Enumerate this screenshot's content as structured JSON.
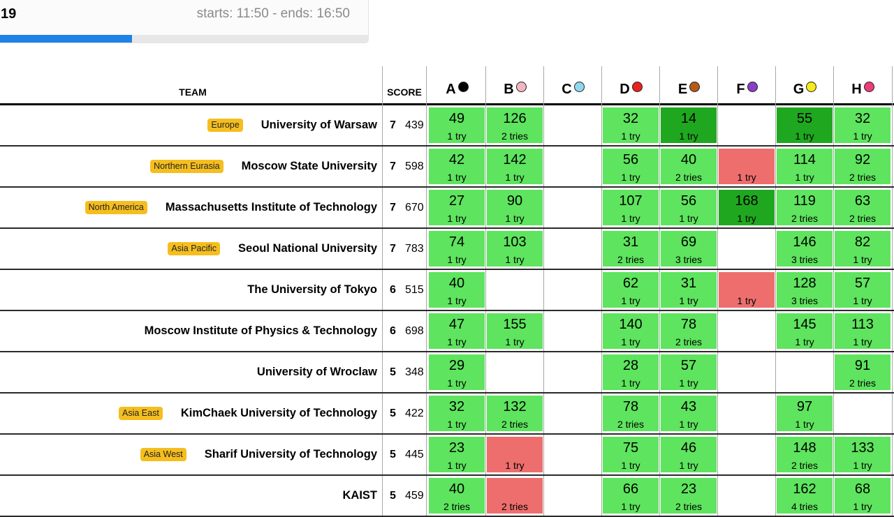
{
  "contest": {
    "id": "19",
    "time": "starts: 11:50 - ends: 16:50",
    "progress_percent": 37
  },
  "header": {
    "team": "TEAM",
    "score": "SCORE"
  },
  "problems": [
    {
      "letter": "A",
      "color": "#000000"
    },
    {
      "letter": "B",
      "color": "#f2b6c2"
    },
    {
      "letter": "C",
      "color": "#8fd8f0"
    },
    {
      "letter": "D",
      "color": "#e8221c"
    },
    {
      "letter": "E",
      "color": "#b45a16"
    },
    {
      "letter": "F",
      "color": "#8a3fc4"
    },
    {
      "letter": "G",
      "color": "#f5ea1a"
    },
    {
      "letter": "H",
      "color": "#ee3b7a"
    }
  ],
  "teams": [
    {
      "region": "Europe",
      "name": "University of Warsaw",
      "solved": "7",
      "penalty": "439",
      "cells": [
        {
          "status": "ok",
          "time": "49",
          "tries": "1 try"
        },
        {
          "status": "ok",
          "time": "126",
          "tries": "2 tries"
        },
        null,
        {
          "status": "ok",
          "time": "32",
          "tries": "1 try"
        },
        {
          "status": "first",
          "time": "14",
          "tries": "1 try"
        },
        null,
        {
          "status": "first",
          "time": "55",
          "tries": "1 try"
        },
        {
          "status": "ok",
          "time": "32",
          "tries": "1 try"
        }
      ]
    },
    {
      "region": "Northern Eurasia",
      "name": "Moscow State University",
      "solved": "7",
      "penalty": "598",
      "cells": [
        {
          "status": "ok",
          "time": "42",
          "tries": "1 try"
        },
        {
          "status": "ok",
          "time": "142",
          "tries": "1 try"
        },
        null,
        {
          "status": "ok",
          "time": "56",
          "tries": "1 try"
        },
        {
          "status": "ok",
          "time": "40",
          "tries": "2 tries"
        },
        {
          "status": "fail",
          "time": "",
          "tries": "1 try"
        },
        {
          "status": "ok",
          "time": "114",
          "tries": "1 try"
        },
        {
          "status": "ok",
          "time": "92",
          "tries": "2 tries"
        }
      ]
    },
    {
      "region": "North America",
      "name": "Massachusetts Institute of Technology",
      "solved": "7",
      "penalty": "670",
      "cells": [
        {
          "status": "ok",
          "time": "27",
          "tries": "1 try"
        },
        {
          "status": "ok",
          "time": "90",
          "tries": "1 try"
        },
        null,
        {
          "status": "ok",
          "time": "107",
          "tries": "1 try"
        },
        {
          "status": "ok",
          "time": "56",
          "tries": "1 try"
        },
        {
          "status": "first",
          "time": "168",
          "tries": "1 try"
        },
        {
          "status": "ok",
          "time": "119",
          "tries": "2 tries"
        },
        {
          "status": "ok",
          "time": "63",
          "tries": "2 tries"
        }
      ]
    },
    {
      "region": "Asia Pacific",
      "name": "Seoul National University",
      "solved": "7",
      "penalty": "783",
      "cells": [
        {
          "status": "ok",
          "time": "74",
          "tries": "1 try"
        },
        {
          "status": "ok",
          "time": "103",
          "tries": "1 try"
        },
        null,
        {
          "status": "ok",
          "time": "31",
          "tries": "2 tries"
        },
        {
          "status": "ok",
          "time": "69",
          "tries": "3 tries"
        },
        null,
        {
          "status": "ok",
          "time": "146",
          "tries": "3 tries"
        },
        {
          "status": "ok",
          "time": "82",
          "tries": "1 try"
        }
      ]
    },
    {
      "region": "",
      "name": "The University of Tokyo",
      "solved": "6",
      "penalty": "515",
      "cells": [
        {
          "status": "ok",
          "time": "40",
          "tries": "1 try"
        },
        null,
        null,
        {
          "status": "ok",
          "time": "62",
          "tries": "1 try"
        },
        {
          "status": "ok",
          "time": "31",
          "tries": "1 try"
        },
        {
          "status": "fail",
          "time": "",
          "tries": "1 try"
        },
        {
          "status": "ok",
          "time": "128",
          "tries": "3 tries"
        },
        {
          "status": "ok",
          "time": "57",
          "tries": "1 try"
        }
      ]
    },
    {
      "region": "",
      "name": "Moscow Institute of Physics & Technology",
      "solved": "6",
      "penalty": "698",
      "cells": [
        {
          "status": "ok",
          "time": "47",
          "tries": "1 try"
        },
        {
          "status": "ok",
          "time": "155",
          "tries": "1 try"
        },
        null,
        {
          "status": "ok",
          "time": "140",
          "tries": "1 try"
        },
        {
          "status": "ok",
          "time": "78",
          "tries": "2 tries"
        },
        null,
        {
          "status": "ok",
          "time": "145",
          "tries": "1 try"
        },
        {
          "status": "ok",
          "time": "113",
          "tries": "1 try"
        }
      ]
    },
    {
      "region": "",
      "name": "University of Wroclaw",
      "solved": "5",
      "penalty": "348",
      "cells": [
        {
          "status": "ok",
          "time": "29",
          "tries": "1 try"
        },
        null,
        null,
        {
          "status": "ok",
          "time": "28",
          "tries": "1 try"
        },
        {
          "status": "ok",
          "time": "57",
          "tries": "1 try"
        },
        null,
        null,
        {
          "status": "ok",
          "time": "91",
          "tries": "2 tries"
        }
      ]
    },
    {
      "region": "Asia East",
      "name": "KimChaek University of Technology",
      "solved": "5",
      "penalty": "422",
      "cells": [
        {
          "status": "ok",
          "time": "32",
          "tries": "1 try"
        },
        {
          "status": "ok",
          "time": "132",
          "tries": "2 tries"
        },
        null,
        {
          "status": "ok",
          "time": "78",
          "tries": "2 tries"
        },
        {
          "status": "ok",
          "time": "43",
          "tries": "1 try"
        },
        null,
        {
          "status": "ok",
          "time": "97",
          "tries": "1 try"
        },
        null
      ]
    },
    {
      "region": "Asia West",
      "name": "Sharif University of Technology",
      "solved": "5",
      "penalty": "445",
      "cells": [
        {
          "status": "ok",
          "time": "23",
          "tries": "1 try"
        },
        {
          "status": "fail",
          "time": "",
          "tries": "1 try"
        },
        null,
        {
          "status": "ok",
          "time": "75",
          "tries": "1 try"
        },
        {
          "status": "ok",
          "time": "46",
          "tries": "1 try"
        },
        null,
        {
          "status": "ok",
          "time": "148",
          "tries": "2 tries"
        },
        {
          "status": "ok",
          "time": "133",
          "tries": "1 try"
        }
      ]
    },
    {
      "region": "",
      "name": "KAIST",
      "solved": "5",
      "penalty": "459",
      "cells": [
        {
          "status": "ok",
          "time": "40",
          "tries": "2 tries"
        },
        {
          "status": "fail",
          "time": "",
          "tries": "2 tries"
        },
        null,
        {
          "status": "ok",
          "time": "66",
          "tries": "1 try"
        },
        {
          "status": "ok",
          "time": "23",
          "tries": "2 tries"
        },
        null,
        {
          "status": "ok",
          "time": "162",
          "tries": "4 tries"
        },
        {
          "status": "ok",
          "time": "68",
          "tries": "1 try"
        }
      ]
    }
  ]
}
